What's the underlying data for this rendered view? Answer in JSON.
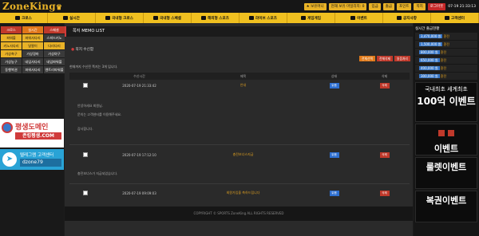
{
  "header": {
    "logo": "ZoneKing",
    "buttons": [
      "★ 보유머니",
      "현재 보유 마일리지: 0",
      "입금",
      "출금",
      "포인트",
      "쪽지",
      "로그아웃"
    ],
    "clock": "07-19 21:33:13"
  },
  "nav": [
    "크로스",
    "실시간",
    "국내형 크로스",
    "국내형 스페셜",
    "해외형 스포츠",
    "라이브 스포츠",
    "게임게임",
    "이벤트",
    "공지사항",
    "고객센터"
  ],
  "left_grid": [
    "크로스",
    "실시간",
    "스페셜",
    "파워볼",
    "파워사다리",
    "스피드키노",
    "키노사다리",
    "달팔이",
    "다리다리",
    "가상축구",
    "가상경마",
    "가상야구",
    "가상농구",
    "네임사다리",
    "네임파워볼",
    "동행복권",
    "파워사다리",
    "엔트리파워볼"
  ],
  "banners": {
    "domain_title": "평생도메인",
    "domain_sub": "존킹평생.COM",
    "tg_title": "텔레그램 고객센터",
    "tg_id": "dzone79"
  },
  "main": {
    "title": "쪽지 MEMO LIST",
    "subtab": "쪽지 수신함",
    "actions": [
      "전체선택",
      "전체삭제",
      "읽음처리"
    ],
    "info": "현재까지 수신된 쪽지는 3개 입니다.",
    "columns": [
      "",
      "수신시간",
      "제목",
      "상태",
      "삭제"
    ],
    "rows": [
      {
        "time": "2020-07-19 21:33:42",
        "subject": "안내",
        "status": "읽음",
        "delete": "삭제"
      },
      {
        "time": "2020-07-19 17:12:10",
        "subject": "충전보너스지급",
        "status": "읽음",
        "delete": "삭제"
      },
      {
        "time": "2020-07-19 09:09:03",
        "subject": "회원가입을 축하드립니다",
        "status": "읽음",
        "delete": "삭제"
      }
    ],
    "message_lines": [
      "안녕하세요 회원님.",
      "문의는 고객센터를 이용해주세요.",
      "감사합니다.",
      "충전보너스가 지급되었습니다."
    ],
    "footer": "COPYRIGHT © SPORTS ZoneKing ALL RIGHTS RESERVED"
  },
  "right": {
    "header": "실시간 출금현황",
    "withdrawals": [
      {
        "amount": "3,470,000 원",
        "label": "환전"
      },
      {
        "amount": "1,500,000 원",
        "label": "환전"
      },
      {
        "amount": "800,000 원",
        "label": "환전"
      },
      {
        "amount": "650,000 원",
        "label": "환전"
      },
      {
        "amount": "400,000 원",
        "label": "환전"
      },
      {
        "amount": "300,000 원",
        "label": "환전"
      }
    ],
    "banners": [
      {
        "line1": "국내최초 세계최초",
        "line2": "100억 이벤트"
      },
      {
        "line1": "",
        "line2": "이벤트"
      },
      {
        "line1": "",
        "line2": "룰렛이벤트"
      },
      {
        "line1": "",
        "line2": "복권이벤트"
      }
    ]
  },
  "colors": {
    "accent": "#f0c020",
    "danger": "#c0392b",
    "primary": "#2e6fd0"
  }
}
